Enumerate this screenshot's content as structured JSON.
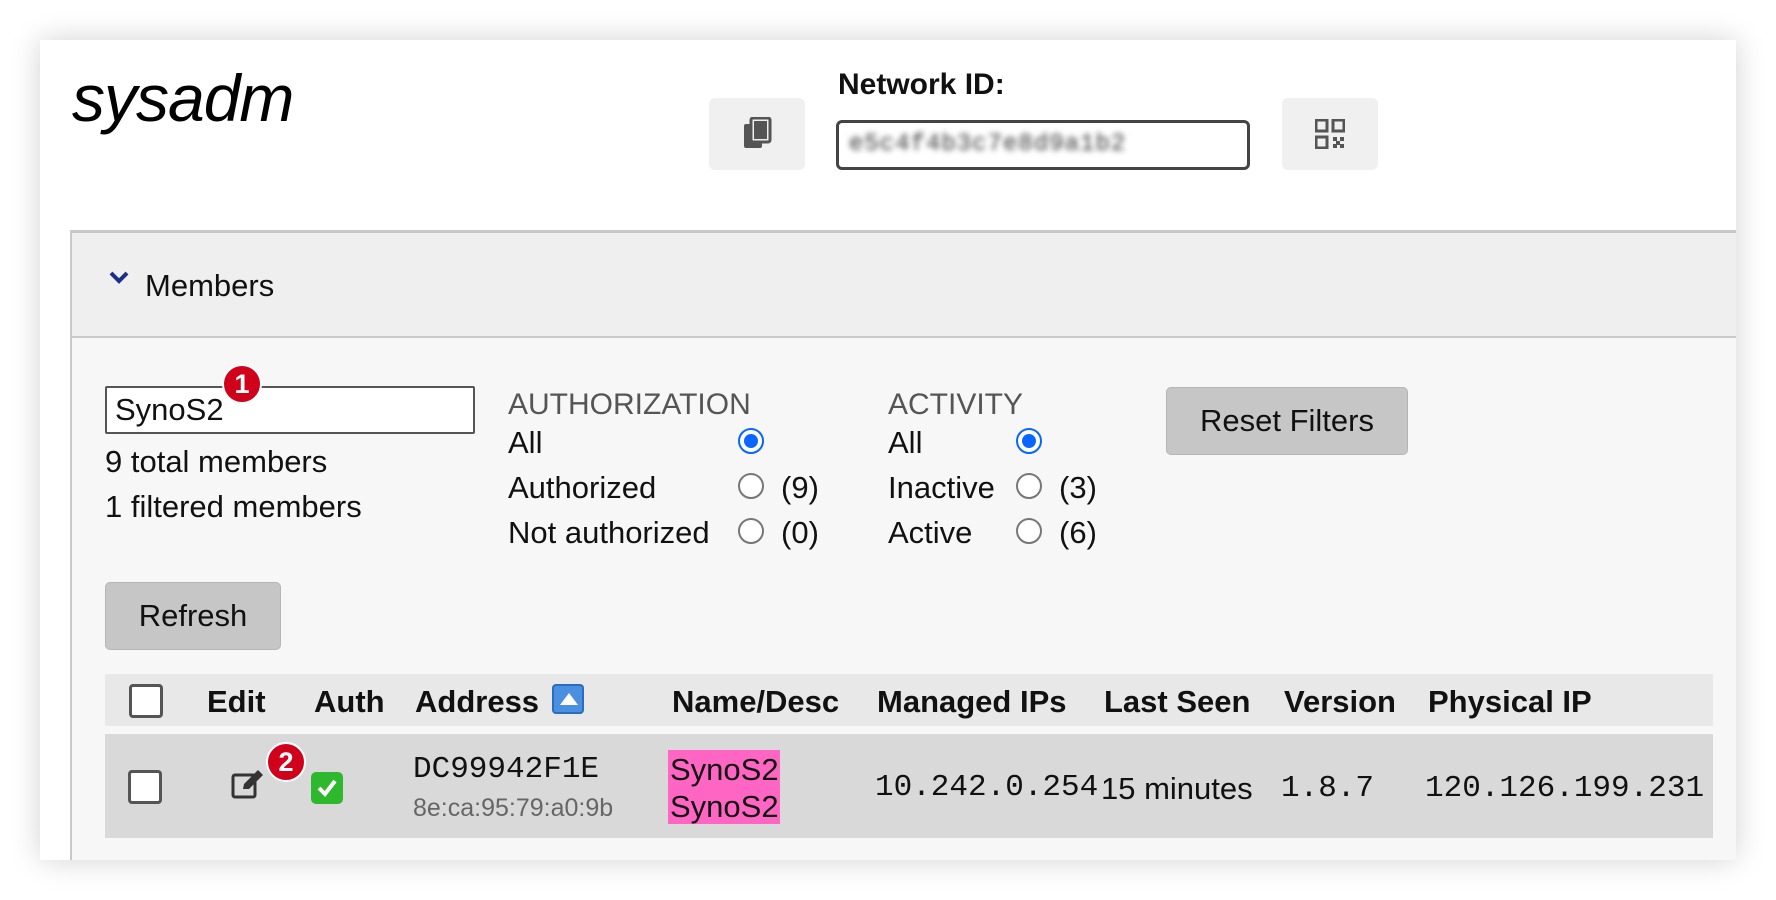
{
  "app": {
    "brand": "sysadm"
  },
  "network": {
    "label": "Network ID:",
    "value": "e5c4f4b3c7e8d9a1b2"
  },
  "members_section": {
    "title": "Members"
  },
  "search": {
    "value": "SynoS2"
  },
  "counts": {
    "total": "9 total members",
    "filtered": "1 filtered members"
  },
  "annotations": {
    "first": "1",
    "second": "2"
  },
  "authorization": {
    "heading": "AUTHORIZATION",
    "options": [
      {
        "label": "All",
        "count": "",
        "checked": true
      },
      {
        "label": "Authorized",
        "count": "(9)",
        "checked": false
      },
      {
        "label": "Not authorized",
        "count": "(0)",
        "checked": false
      }
    ]
  },
  "activity": {
    "heading": "ACTIVITY",
    "options": [
      {
        "label": "All",
        "count": "",
        "checked": true
      },
      {
        "label": "Inactive",
        "count": "(3)",
        "checked": false
      },
      {
        "label": "Active",
        "count": "(6)",
        "checked": false
      }
    ]
  },
  "buttons": {
    "reset": "Reset Filters",
    "refresh": "Refresh"
  },
  "table": {
    "headers": [
      "Edit",
      "Auth",
      "Address",
      "Name/Desc",
      "Managed IPs",
      "Last Seen",
      "Version",
      "Physical IP"
    ],
    "rows": [
      {
        "address": "DC99942F1E",
        "mac": "8e:ca:95:79:a0:9b",
        "name": "SynoS2",
        "desc": "SynoS2",
        "managed_ip": "10.242.0.254",
        "last_seen": "15 minutes",
        "version": "1.8.7",
        "physical_ip": "120.126.199.231"
      }
    ]
  },
  "icons": {
    "copy": "copy-icon",
    "qr": "qr-code-icon",
    "chevron": "chevron-down-icon",
    "edit": "edit-icon",
    "auth": "check-icon",
    "sort": "sort-ascending-icon"
  },
  "colors": {
    "accent": "#0a66ff",
    "badge": "#d0021b",
    "highlight": "#ff66c4",
    "auth_check": "#2eb82e"
  }
}
